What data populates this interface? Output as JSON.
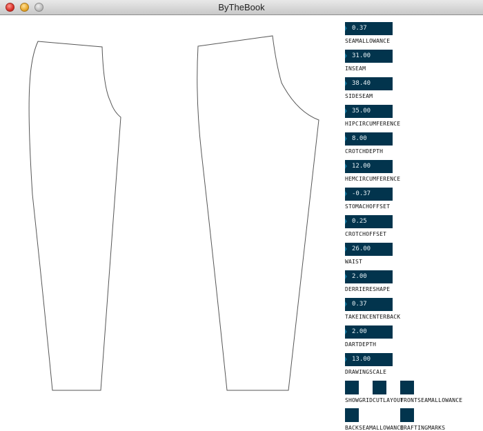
{
  "window": {
    "title": "ByTheBook"
  },
  "controls": [
    {
      "value": "0.37",
      "label": "SEAMALLOWANCE"
    },
    {
      "value": "31.00",
      "label": "INSEAM"
    },
    {
      "value": "38.40",
      "label": "SIDESEAM"
    },
    {
      "value": "35.00",
      "label": "HIPCIRCUMFERENCE"
    },
    {
      "value": "8.00",
      "label": "CROTCHDEPTH"
    },
    {
      "value": "12.00",
      "label": "HEMCIRCUMFERENCE"
    },
    {
      "value": "-0.37",
      "label": "STOMACHOFFSET"
    },
    {
      "value": "0.25",
      "label": "CROTCHOFFSET"
    },
    {
      "value": "26.00",
      "label": "WAIST"
    },
    {
      "value": "2.00",
      "label": "DERRIERESHAPE"
    },
    {
      "value": "0.37",
      "label": "TAKEINCENTERBACK"
    },
    {
      "value": "2.00",
      "label": "DARTDEPTH"
    },
    {
      "value": "13.00",
      "label": "DRAWINGSCALE"
    }
  ],
  "toggles": [
    {
      "label": "SHOWGRID"
    },
    {
      "label": "CUTLAYOUT"
    },
    {
      "label": "FRONTSEAMALLOWANCE"
    },
    {
      "label": "BACKSEAMALLOWANCE"
    },
    {
      "label": "DRAFTINGMARKS"
    }
  ],
  "colors": {
    "control_bg": "#02344d",
    "pattern_stroke": "#555555"
  }
}
